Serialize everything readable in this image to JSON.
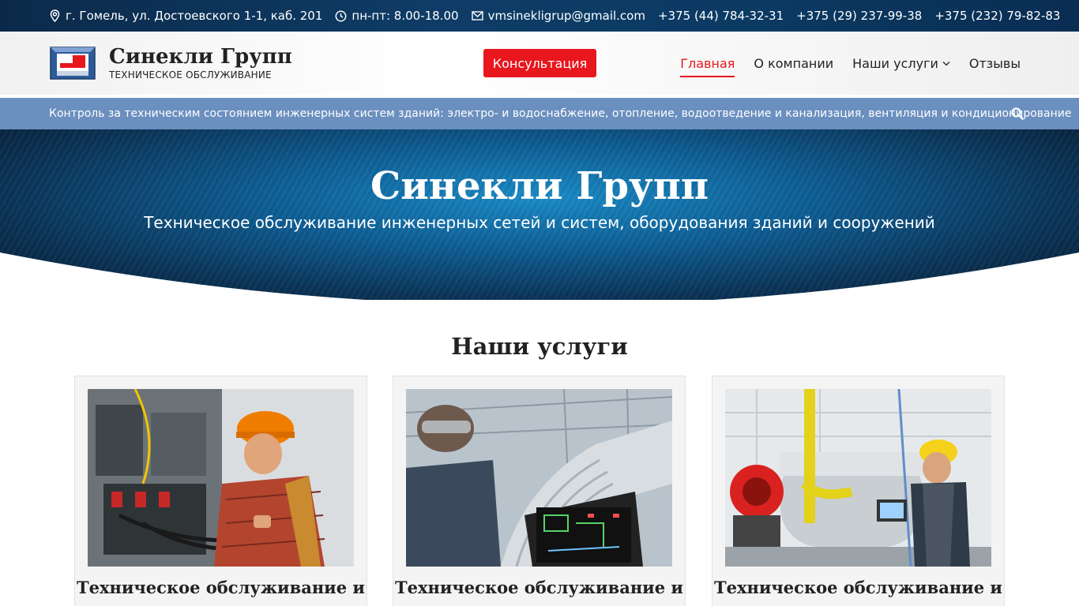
{
  "topbar": {
    "address": "г. Гомель, ул. Достоевского 1-1, каб. 201",
    "hours": "пн-пт: 8.00-18.00",
    "email": "vmsinekligrup@gmail.com",
    "phones": [
      "+375 (44) 784-32-31",
      "+375 (29) 237-99-38",
      "+375 (232) 79-82-83"
    ]
  },
  "header": {
    "logo_title": "Синекли Групп",
    "logo_subtitle": "ТЕХНИЧЕСКОЕ ОБСЛУЖИВАНИЕ",
    "consult_label": "Консультация",
    "nav": [
      {
        "label": "Главная",
        "active": true
      },
      {
        "label": "О компании",
        "active": false
      },
      {
        "label": "Наши услуги",
        "active": false,
        "has_dropdown": true
      },
      {
        "label": "Отзывы",
        "active": false
      }
    ]
  },
  "tagbar": {
    "text": "Контроль за техническим состоянием инженерных систем зданий: электро- и водоснабжение, отопление, водоотведение и канализация, вентиляция и кондиционирование",
    "icon": "search-icon"
  },
  "hero": {
    "title": "Синекли Групп",
    "subtitle": "Техническое обслуживание инженерных сетей и систем, оборудования зданий и сооружений"
  },
  "services": {
    "title": "Наши услуги",
    "cards": [
      {
        "title": "Техническое обслуживание и"
      },
      {
        "title": "Техническое обслуживание и"
      },
      {
        "title": "Техническое обслуживание и"
      }
    ]
  },
  "colors": {
    "accent": "#e8161d",
    "tagbar": "#6b8fbf",
    "topbar": "#0e3c66"
  }
}
